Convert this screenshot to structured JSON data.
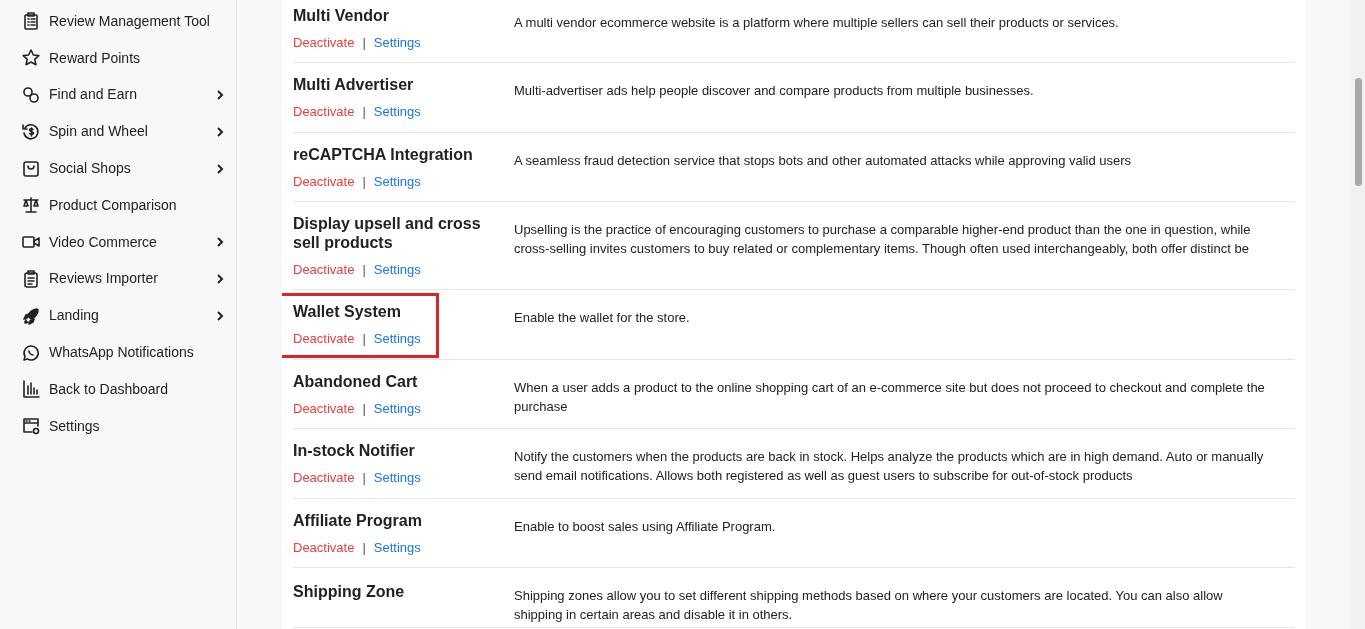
{
  "sidebar": {
    "items": [
      {
        "label": "Review Management Tool",
        "has_submenu": false
      },
      {
        "label": "Reward Points",
        "has_submenu": false
      },
      {
        "label": "Find and Earn",
        "has_submenu": true
      },
      {
        "label": "Spin and Wheel",
        "has_submenu": true
      },
      {
        "label": "Social Shops",
        "has_submenu": true
      },
      {
        "label": "Product Comparison",
        "has_submenu": false
      },
      {
        "label": "Video Commerce",
        "has_submenu": true
      },
      {
        "label": "Reviews Importer",
        "has_submenu": true
      },
      {
        "label": "Landing",
        "has_submenu": true
      },
      {
        "label": "WhatsApp Notifications",
        "has_submenu": false
      },
      {
        "label": "Back to Dashboard",
        "has_submenu": false
      },
      {
        "label": "Settings",
        "has_submenu": false
      }
    ]
  },
  "addons": [
    {
      "title": "Multi Vendor",
      "description": "A multi vendor ecommerce website is a platform where multiple sellers can sell their products or services.",
      "actions": [
        "Deactivate",
        "|",
        "Settings"
      ],
      "highlighted": false
    },
    {
      "title": "Multi Advertiser",
      "description": "Multi-advertiser ads help people discover and compare products from multiple businesses.",
      "actions": [
        "Deactivate",
        "|",
        "Settings"
      ],
      "highlighted": false
    },
    {
      "title": "reCAPTCHA Integration",
      "description": "A seamless fraud detection service that stops bots and other automated attacks while approving valid users",
      "actions": [
        "Deactivate",
        "|",
        "Settings"
      ],
      "highlighted": false
    },
    {
      "title": "Display upsell and cross sell products",
      "description": "Upselling is the practice of encouraging customers to purchase a comparable higher-end product than the one in question, while cross-selling invites customers to buy related or complementary items. Though often used interchangeably, both offer distinct be",
      "actions": [
        "Deactivate",
        "|",
        "Settings"
      ],
      "highlighted": false
    },
    {
      "title": "Wallet System",
      "description": "Enable the wallet for the store.",
      "actions": [
        "Deactivate",
        "|",
        "Settings"
      ],
      "highlighted": true
    },
    {
      "title": "Abandoned Cart",
      "description": "When a user adds a product to the online shopping cart of an e-commerce site but does not proceed to checkout and complete the purchase",
      "actions": [
        "Deactivate",
        "|",
        "Settings"
      ],
      "highlighted": false
    },
    {
      "title": "In-stock Notifier",
      "description": "Notify the customers when the products are back in stock. Helps analyze the products which are in high demand. Auto or manually send email notifications. Allows both registered as well as guest users to subscribe for out-of-stock products",
      "actions": [
        "Deactivate",
        "|",
        "Settings"
      ],
      "highlighted": false
    },
    {
      "title": "Affiliate Program",
      "description": "Enable to boost sales using Affiliate Program.",
      "actions": [
        "Deactivate",
        "|",
        "Settings"
      ],
      "highlighted": false
    },
    {
      "title": "Shipping Zone",
      "description": "Shipping zones allow you to set different shipping methods based on where your customers are located. You can also allow shipping in certain areas and disable it in others.",
      "highlighted": false
    }
  ]
}
